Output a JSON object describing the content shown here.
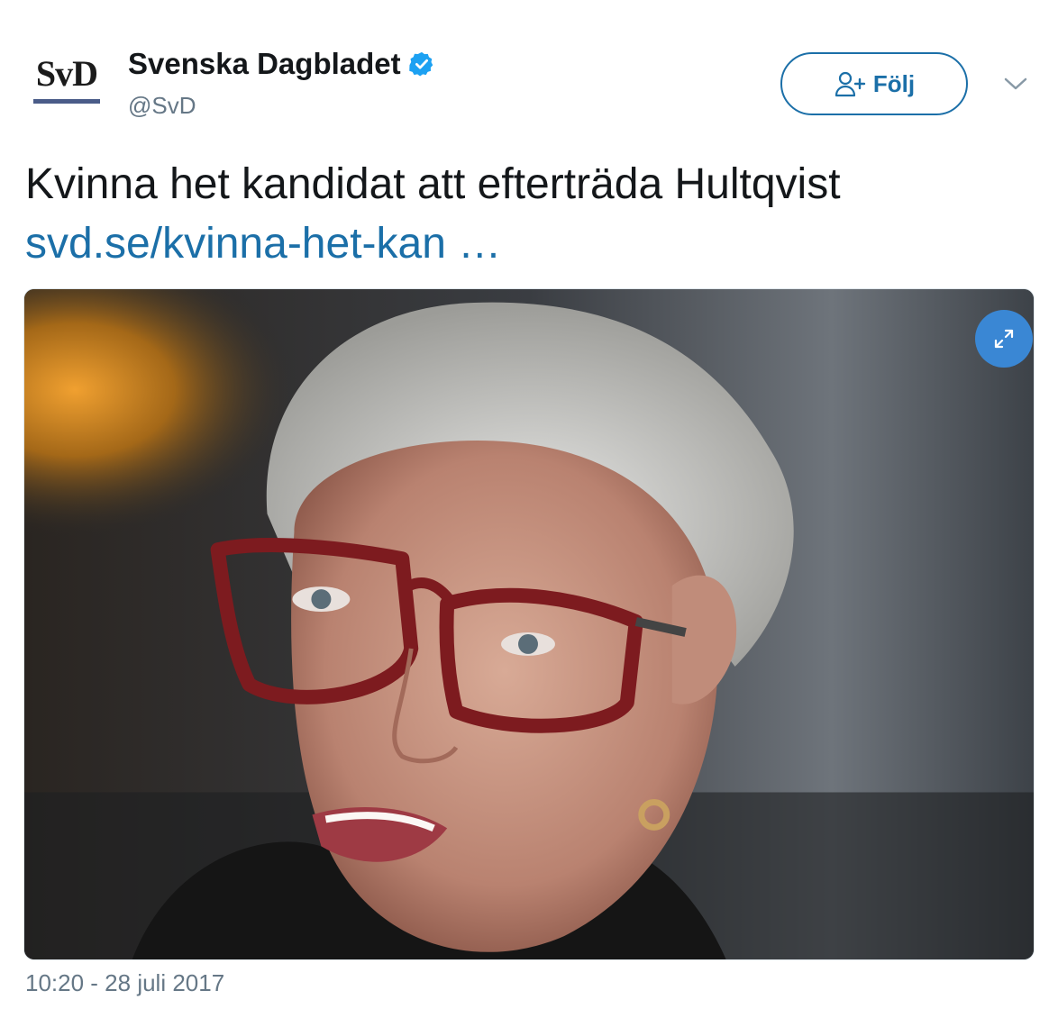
{
  "account": {
    "avatar_text": "SvD",
    "display_name": "Svenska Dagbladet",
    "handle": "@SvD",
    "verified_icon": "verified-badge-icon"
  },
  "actions": {
    "follow_label": "Följ",
    "follow_icon": "add-user-icon",
    "more_icon": "chevron-down-icon"
  },
  "tweet": {
    "text": "Kvinna het kandidat att efterträda Hultqvist",
    "link_text": "svd.se/kvinna-het-kan …",
    "timestamp": "10:20 - 28 juli 2017"
  },
  "media": {
    "type": "photo",
    "expand_icon": "expand-icon"
  },
  "colors": {
    "link": "#1b6fa8",
    "secondary_text": "#657786",
    "verified": "#1da1f2",
    "expand_button": "#3a87d4"
  }
}
